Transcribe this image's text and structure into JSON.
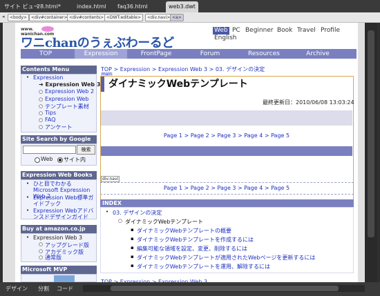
{
  "tabs": [
    {
      "label": "サイト ビュー",
      "active": false
    },
    {
      "label": "28.html*",
      "active": false
    },
    {
      "label": "index.html",
      "active": false
    },
    {
      "label": "faq36.html",
      "active": false
    },
    {
      "label": "web3.dwt",
      "active": true
    }
  ],
  "tag_selector": [
    "<body>",
    "<div#container>",
    "<div#contents>",
    "<DWT:editable>",
    "<div.navi>",
    "<a>"
  ],
  "site": {
    "logo_small": "www.\nwanichan.com",
    "logo": "ワニchanのうぇぶわーるど",
    "languages": [
      "Web",
      "PC",
      "Beginner",
      "Book",
      "Travel",
      "Profile",
      "English"
    ],
    "active_language": "Web",
    "nav": [
      "TOP",
      "Expression",
      "FrontPage",
      "Forum",
      "Resources",
      "Archive"
    ],
    "active_nav": "Expression"
  },
  "sidebar": {
    "contents_menu_title": "Contents Menu",
    "menu_items": [
      "Expression",
      "➜ Expression Web 3",
      "Expression Web 2",
      "Expression Web",
      "テンプレート素材",
      "Tips",
      "FAQ",
      "アンケート"
    ],
    "search_title": "Site Search by Google",
    "search_button": "検索",
    "search_options": [
      "Web",
      "サイト内"
    ],
    "search_selected": "サイト内",
    "books_title": "Expression Web Books",
    "books": [
      "ひと目でわかるMicrosoft Expression Web 2",
      "Expression Web標準ガイドブック",
      "Expression Webアドバンスドデザインガイド"
    ],
    "amazon_title": "Buy at amazon.co.jp Now",
    "amazon_items": [
      "Expression Web 3",
      "アップグレード版",
      "アカデミック版",
      "通常版"
    ],
    "mvp_title": "Microsoft MVP"
  },
  "main": {
    "breadcrumb": "TOP > Expression > Expression Web 3 > 03. デザインの決定",
    "region_label": "main",
    "title": "ダイナミックWebテンプレート",
    "last_updated": "最終更新日：2010/06/08 13:03:24",
    "pager": "Page 1 > Page 2 > Page 3 > Page 4 > Page 5",
    "navi_label": "div.navi",
    "index_title": "INDEX",
    "index_level1": "03. デザインの決定",
    "index_level2": "ダイナミックWebテンプレート",
    "index_level3": [
      "ダイナミックWebテンプレートの概要",
      "ダイナミックWebテンプレートを作成するには",
      "編集可能な領域を設定、変更、削除するには",
      "ダイナミックWebテンプレートが適用されたWebページを更新するには",
      "ダイナミックWebテンプレートを運用、解除するには"
    ],
    "breadcrumb_bottom": "TOP > Expression > Expression Web 3"
  },
  "bottom_tabs": [
    "デザイン",
    "分割",
    "コード"
  ]
}
